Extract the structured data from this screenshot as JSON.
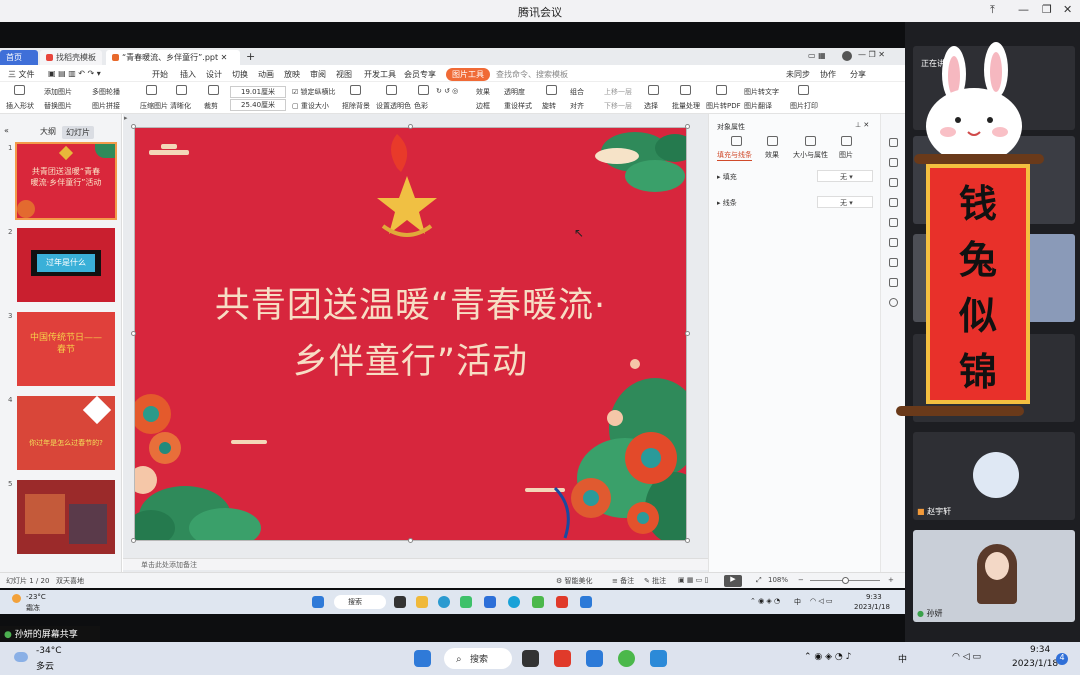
{
  "meeting": {
    "title": "腾讯会议",
    "share_label": "孙妍的屏幕共享"
  },
  "wps": {
    "tabs": [
      "首页",
      "找稻壳模板",
      "“青春暖流、乡伴童行”.ppt"
    ],
    "menus": [
      "三 文件",
      "开始",
      "插入",
      "设计",
      "切换",
      "动画",
      "放映",
      "审阅",
      "视图",
      "开发工具",
      "会员专享",
      "图片工具",
      "查找命令、搜索模板"
    ],
    "right_menus": [
      "未同步",
      "协作",
      "分享"
    ],
    "ribbon": [
      "插入形状",
      "添加图片",
      "多图轮播",
      "替换图片",
      "图片拼接",
      "压缩图片",
      "清晰化",
      "裁剪",
      "19.01厘米",
      "25.40厘米",
      "锁定纵横比",
      "重设大小",
      "抠除背景",
      "设置透明色",
      "色彩",
      "效果",
      "边框",
      "透明度",
      "重设样式",
      "组合",
      "旋转",
      "对齐",
      "上移一层",
      "下移一层",
      "选择",
      "批量处理",
      "图片转PDF",
      "图片转文字",
      "图片翻译",
      "图片打印"
    ],
    "panel_tabs": [
      "大纲",
      "幻灯片"
    ],
    "thumbs": [
      {
        "num": "1",
        "text": "共青团送温暖“青春暖流·乡伴童行”活动"
      },
      {
        "num": "2",
        "text": "过年是什么"
      },
      {
        "num": "3",
        "text": "中国传统节日——春节"
      },
      {
        "num": "4",
        "text": "你过年是怎么过春节的?"
      },
      {
        "num": "5",
        "text": ""
      }
    ],
    "slide_title_line1": "共青团送温暖“青春暖流·",
    "slide_title_line2": "乡伴童行”活动",
    "notes_hint": "单击此处添加备注",
    "prop": {
      "header": "对象属性",
      "tabs": [
        "填充与线条",
        "效果",
        "大小与属性",
        "图片"
      ],
      "fill": "填充",
      "line": "线条",
      "none": "无"
    },
    "status": {
      "slide": "幻灯片 1 / 20",
      "theme": "双天喜地",
      "smart": "智能美化",
      "notes": "备注",
      "comment": "批注",
      "zoom": "108%"
    }
  },
  "inner_taskbar": {
    "temp": "-23°C",
    "cond": "霜冻",
    "search": "搜索",
    "lang": "中",
    "time": "9:33",
    "date": "2023/1/18"
  },
  "participants": {
    "speaking": "正在讲话",
    "p1": "赵宇轩",
    "p2": "孙妍"
  },
  "sticker": {
    "text": [
      "钱",
      "兔",
      "似",
      "锦"
    ]
  },
  "taskbar": {
    "temp": "-34°C",
    "cond": "多云",
    "search": "搜索",
    "lang": "中",
    "time": "9:34",
    "date": "2023/1/18",
    "badge": "4"
  }
}
